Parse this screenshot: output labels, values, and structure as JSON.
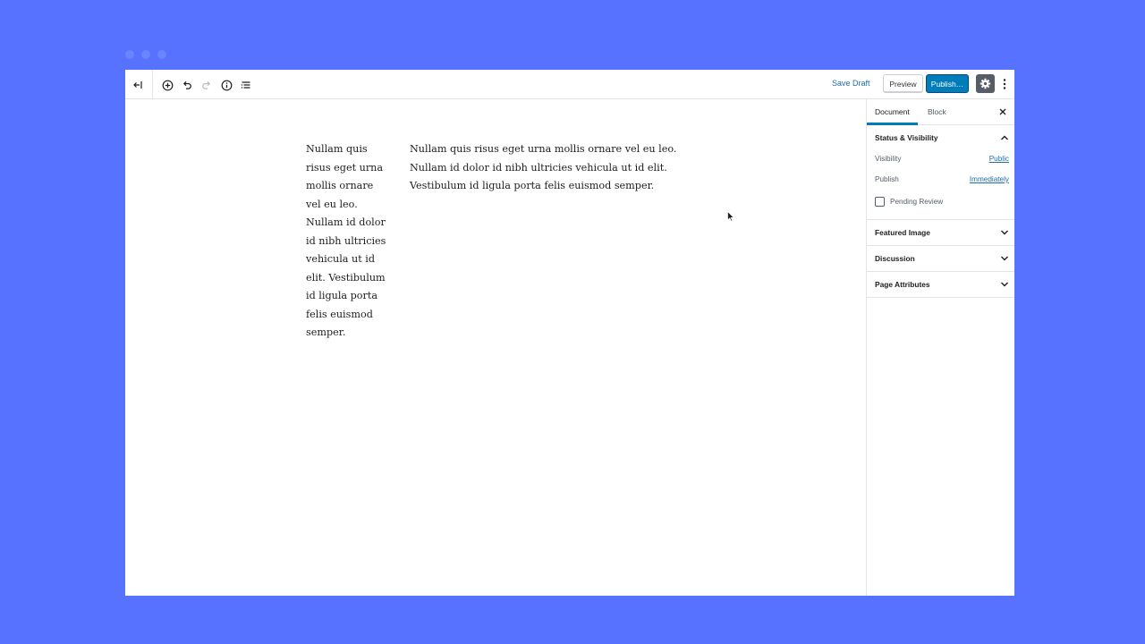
{
  "toolbar": {
    "save_draft": "Save Draft",
    "preview": "Preview",
    "publish": "Publish…",
    "icons": [
      "back-icon",
      "add-block-icon",
      "undo-icon",
      "redo-icon",
      "info-icon",
      "outline-icon",
      "gear-icon",
      "more-vertical-icon"
    ]
  },
  "content": {
    "column_left": "Nullam quis risus eget urna mollis ornare vel eu leo. Nullam id dolor id nibh ultricies vehicula ut id elit. Vestibulum id ligula porta felis euismod semper.",
    "column_right": "Nullam quis risus eget urna mollis ornare vel eu leo. Nullam id dolor id nibh ultricies vehicula ut id elit. Vestibulum id ligula porta felis euismod semper."
  },
  "sidebar": {
    "tabs": [
      {
        "label": "Document",
        "active": true
      },
      {
        "label": "Block",
        "active": false
      }
    ],
    "status_visibility": {
      "title": "Status & Visibility",
      "visibility_label": "Visibility",
      "visibility_value": "Public",
      "publish_label": "Publish",
      "publish_value": "Immediately",
      "pending_review": "Pending Review"
    },
    "panels": [
      "Featured Image",
      "Discussion",
      "Page Attributes"
    ]
  },
  "colors": {
    "background": "#5772ff",
    "accent": "#007cba",
    "link": "#1e6ea7"
  }
}
